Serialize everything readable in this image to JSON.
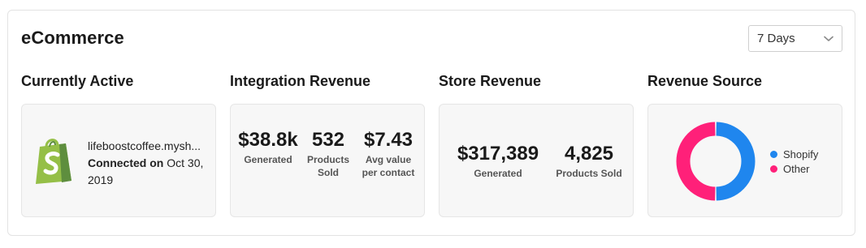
{
  "header": {
    "title": "eCommerce",
    "range_select": {
      "value": "7 Days"
    }
  },
  "sections": {
    "currently_active": {
      "title": "Currently Active",
      "store_url": "lifeboostcoffee.mysh...",
      "connected_label": "Connected on",
      "connected_date": "Oct 30, 2019"
    },
    "integration_revenue": {
      "title": "Integration Revenue",
      "stats": [
        {
          "value": "$38.8k",
          "label": "Generated"
        },
        {
          "value": "532",
          "label": "Products Sold"
        },
        {
          "value": "$7.43",
          "label": "Avg value per contact"
        }
      ]
    },
    "store_revenue": {
      "title": "Store Revenue",
      "stats": [
        {
          "value": "$317,389",
          "label": "Generated"
        },
        {
          "value": "4,825",
          "label": "Products Sold"
        }
      ]
    },
    "revenue_source": {
      "title": "Revenue Source",
      "chart_data": {
        "type": "pie",
        "donut": true,
        "categories": [
          "Shopify",
          "Other"
        ],
        "values": [
          50,
          50
        ],
        "colors": [
          "#1f86ee",
          "#ff2079"
        ],
        "legend": "right"
      }
    }
  },
  "colors": {
    "shopify_green": "#95bf47",
    "shopify_dark": "#5e8e3e"
  }
}
